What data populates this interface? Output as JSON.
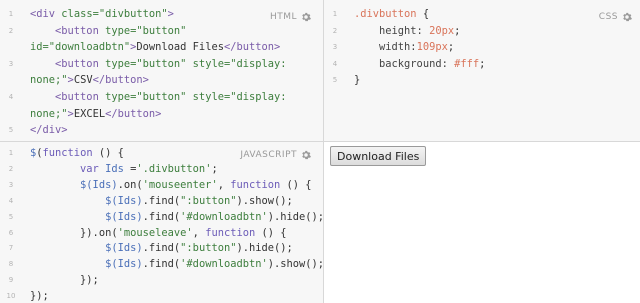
{
  "panes": {
    "html": {
      "label": "HTML",
      "line_numbers": [
        "1",
        "2",
        "3",
        "4",
        "5"
      ],
      "lines": [
        [
          {
            "t": "<",
            "c": "tag"
          },
          {
            "t": "div",
            "c": "tag"
          },
          {
            "t": " class=",
            "c": "attr"
          },
          {
            "t": "\"divbutton\"",
            "c": "str"
          },
          {
            "t": ">",
            "c": "tag"
          }
        ],
        [
          {
            "t": "    ",
            "c": ""
          },
          {
            "t": "<button",
            "c": "tag"
          },
          {
            "t": " type=",
            "c": "attr"
          },
          {
            "t": "\"button\"",
            "c": "str"
          }
        ],
        [
          {
            "t": "id=",
            "c": "attr"
          },
          {
            "t": "\"downloadbtn\"",
            "c": "str"
          },
          {
            "t": ">",
            "c": "tag"
          },
          {
            "t": "Download Files",
            "c": ""
          },
          {
            "t": "</button>",
            "c": "tag"
          }
        ],
        [
          {
            "t": "    ",
            "c": ""
          },
          {
            "t": "<button",
            "c": "tag"
          },
          {
            "t": " type=",
            "c": "attr"
          },
          {
            "t": "\"button\"",
            "c": "str"
          },
          {
            "t": " style=",
            "c": "attr"
          },
          {
            "t": "\"display:",
            "c": "str"
          }
        ],
        [
          {
            "t": "none;\"",
            "c": "str"
          },
          {
            "t": ">",
            "c": "tag"
          },
          {
            "t": "CSV",
            "c": ""
          },
          {
            "t": "</button>",
            "c": "tag"
          }
        ],
        [
          {
            "t": "    ",
            "c": ""
          },
          {
            "t": "<button",
            "c": "tag"
          },
          {
            "t": " type=",
            "c": "attr"
          },
          {
            "t": "\"button\"",
            "c": "str"
          },
          {
            "t": " style=",
            "c": "attr"
          },
          {
            "t": "\"display:",
            "c": "str"
          }
        ],
        [
          {
            "t": "none;\"",
            "c": "str"
          },
          {
            "t": ">",
            "c": "tag"
          },
          {
            "t": "EXCEL",
            "c": ""
          },
          {
            "t": "</button>",
            "c": "tag"
          }
        ],
        [
          {
            "t": "</div>",
            "c": "tag"
          }
        ]
      ],
      "line_number_rows": [
        0,
        1,
        null,
        3,
        null,
        4,
        null,
        5
      ]
    },
    "css": {
      "label": "CSS",
      "lines": [
        [
          {
            "t": ".divbutton",
            "c": "sel"
          },
          {
            "t": " {",
            "c": ""
          }
        ],
        [
          {
            "t": "    height: ",
            "c": "prop"
          },
          {
            "t": "20px",
            "c": "num"
          },
          {
            "t": ";",
            "c": ""
          }
        ],
        [
          {
            "t": "    width:",
            "c": "prop"
          },
          {
            "t": "109px",
            "c": "num"
          },
          {
            "t": ";",
            "c": ""
          }
        ],
        [
          {
            "t": "    background: ",
            "c": "prop"
          },
          {
            "t": "#fff",
            "c": "num"
          },
          {
            "t": ";",
            "c": ""
          }
        ],
        [
          {
            "t": "}",
            "c": ""
          }
        ]
      ],
      "line_numbers": [
        "1",
        "2",
        "3",
        "4",
        "5"
      ]
    },
    "js": {
      "label": "JAVASCRIPT",
      "lines": [
        [
          {
            "t": "$",
            "c": "js"
          },
          {
            "t": "(",
            "c": ""
          },
          {
            "t": "function",
            "c": "kw"
          },
          {
            "t": " () {",
            "c": ""
          }
        ],
        [
          {
            "t": "        ",
            "c": ""
          },
          {
            "t": "var",
            "c": "kw"
          },
          {
            "t": " Ids",
            "c": "js"
          },
          {
            "t": " =",
            "c": ""
          },
          {
            "t": "'.divbutton'",
            "c": "str"
          },
          {
            "t": ";",
            "c": ""
          }
        ],
        [
          {
            "t": "        ",
            "c": ""
          },
          {
            "t": "$(Ids)",
            "c": "js"
          },
          {
            "t": ".on(",
            "c": ""
          },
          {
            "t": "'mouseenter'",
            "c": "str"
          },
          {
            "t": ", ",
            "c": ""
          },
          {
            "t": "function",
            "c": "kw"
          },
          {
            "t": " () {",
            "c": ""
          }
        ],
        [
          {
            "t": "            ",
            "c": ""
          },
          {
            "t": "$(Ids)",
            "c": "js"
          },
          {
            "t": ".find(",
            "c": ""
          },
          {
            "t": "\":button\"",
            "c": "str"
          },
          {
            "t": ").show();",
            "c": ""
          }
        ],
        [
          {
            "t": "            ",
            "c": ""
          },
          {
            "t": "$(Ids)",
            "c": "js"
          },
          {
            "t": ".find(",
            "c": ""
          },
          {
            "t": "'#downloadbtn'",
            "c": "str"
          },
          {
            "t": ").hide();",
            "c": ""
          }
        ],
        [
          {
            "t": "        }).on(",
            "c": ""
          },
          {
            "t": "'mouseleave'",
            "c": "str"
          },
          {
            "t": ", ",
            "c": ""
          },
          {
            "t": "function",
            "c": "kw"
          },
          {
            "t": " () {",
            "c": ""
          }
        ],
        [
          {
            "t": "            ",
            "c": ""
          },
          {
            "t": "$(Ids)",
            "c": "js"
          },
          {
            "t": ".find(",
            "c": ""
          },
          {
            "t": "\":button\"",
            "c": "str"
          },
          {
            "t": ").hide();",
            "c": ""
          }
        ],
        [
          {
            "t": "            ",
            "c": ""
          },
          {
            "t": "$(Ids)",
            "c": "js"
          },
          {
            "t": ".find(",
            "c": ""
          },
          {
            "t": "'#downloadbtn'",
            "c": "str"
          },
          {
            "t": ").show();",
            "c": ""
          }
        ],
        [
          {
            "t": "        });",
            "c": ""
          }
        ],
        [
          {
            "t": "});",
            "c": ""
          }
        ]
      ],
      "line_numbers": [
        "1",
        "2",
        "3",
        "4",
        "5",
        "6",
        "7",
        "8",
        "9",
        "10"
      ]
    }
  },
  "result": {
    "button_label": "Download Files"
  },
  "icons": {
    "settings": "gear-icon"
  }
}
